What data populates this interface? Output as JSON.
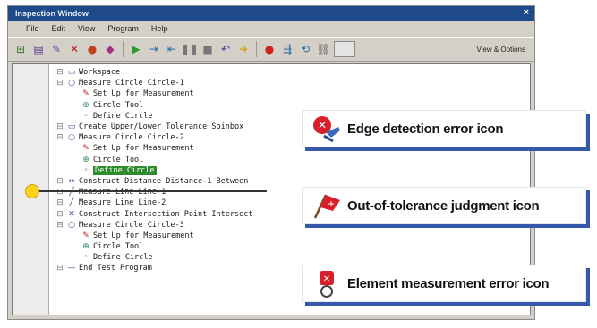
{
  "window": {
    "title": "Inspection Window",
    "close_glyph": "×"
  },
  "menu": [
    "File",
    "Edit",
    "View",
    "Program",
    "Help"
  ],
  "toolbar": {
    "icons": [
      "add-icon",
      "program-icon",
      "edit-icon",
      "delete-icon",
      "record-icon",
      "tag-icon",
      "play-icon",
      "step-icon",
      "step-over-icon",
      "pause-icon",
      "stop-icon",
      "undo-icon",
      "next-icon",
      "record-dot-icon",
      "run-to-icon",
      "loop-icon",
      "link-icon",
      "window-icon"
    ],
    "view_options": "View & Options"
  },
  "tree": [
    {
      "indent": 0,
      "icon": "folder-icon",
      "glyph": "▭",
      "label": "Workspace"
    },
    {
      "indent": 0,
      "icon": "circle-icon",
      "glyph": "○",
      "label": "Measure Circle Circle-1"
    },
    {
      "indent": 1,
      "icon": "setup-icon",
      "glyph": "✎",
      "label": "Set Up for Measurement"
    },
    {
      "indent": 1,
      "icon": "circle-tool-icon",
      "glyph": "⊕",
      "label": "Circle Tool"
    },
    {
      "indent": 1,
      "icon": "define-icon",
      "glyph": "◦",
      "label": "Define Circle"
    },
    {
      "indent": 0,
      "icon": "tolerance-icon",
      "glyph": "▭",
      "label": "Create Upper/Lower Tolerance Spinbox"
    },
    {
      "indent": 0,
      "icon": "circle-icon",
      "glyph": "○",
      "label": "Measure Circle Circle-2"
    },
    {
      "indent": 1,
      "icon": "setup-icon",
      "glyph": "✎",
      "label": "Set Up for Measurement"
    },
    {
      "indent": 1,
      "icon": "circle-tool-icon",
      "glyph": "⊕",
      "label": "Circle Tool"
    },
    {
      "indent": 1,
      "icon": "define-icon",
      "glyph": "◦",
      "label": "Define Circle",
      "selected": true
    },
    {
      "indent": 0,
      "icon": "distance-icon",
      "glyph": "↔",
      "label": "Construct Distance Distance-1 Between"
    },
    {
      "indent": 0,
      "icon": "line-icon",
      "glyph": "╱",
      "label": "Measure Line Line-1"
    },
    {
      "indent": 0,
      "icon": "line-icon",
      "glyph": "╱",
      "label": "Measure Line Line-2"
    },
    {
      "indent": 0,
      "icon": "point-icon",
      "glyph": "✕",
      "label": "Construct Intersection Point Intersect"
    },
    {
      "indent": 0,
      "icon": "circle-icon",
      "glyph": "○",
      "label": "Measure Circle Circle-3"
    },
    {
      "indent": 1,
      "icon": "setup-icon",
      "glyph": "✎",
      "label": "Set Up for Measurement"
    },
    {
      "indent": 1,
      "icon": "circle-tool-icon",
      "glyph": "⊕",
      "label": "Circle Tool"
    },
    {
      "indent": 1,
      "icon": "define-icon",
      "glyph": "◦",
      "label": "Define Circle"
    },
    {
      "indent": 0,
      "icon": "end-icon",
      "glyph": "—",
      "label": "End Test Program"
    }
  ],
  "callouts": [
    {
      "label": "Edge detection error icon",
      "icon": "edge-detection-error-icon"
    },
    {
      "label": "Out-of-tolerance judgment icon",
      "icon": "out-of-tolerance-flag-icon"
    },
    {
      "label": "Element measurement error icon",
      "icon": "element-measurement-error-icon"
    }
  ],
  "colors": {
    "accent": "#3558a8",
    "error": "#d8202a",
    "selected": "#2e8b2e"
  }
}
